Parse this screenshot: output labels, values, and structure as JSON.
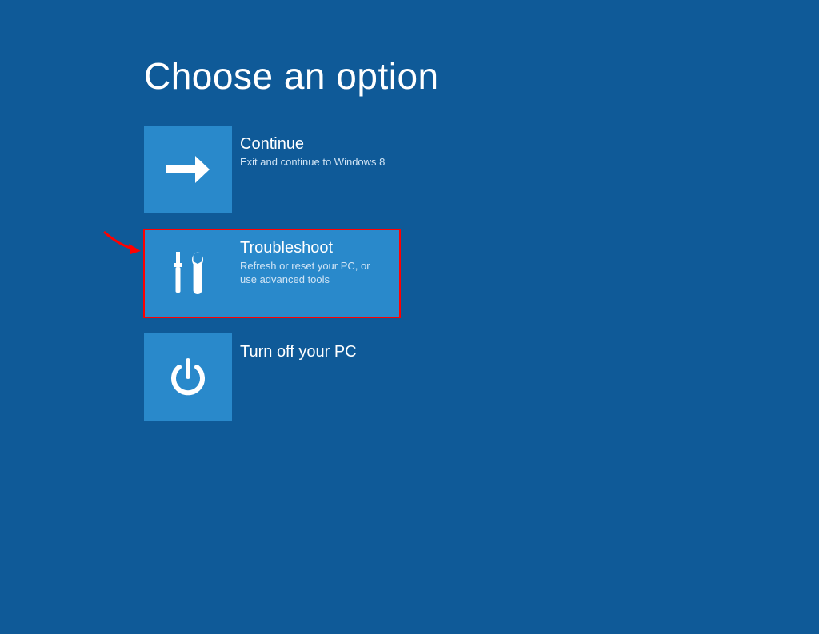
{
  "header": {
    "title": "Choose an option"
  },
  "options": [
    {
      "icon": "arrow-right-icon",
      "title": "Continue",
      "description": "Exit and continue to Windows 8"
    },
    {
      "icon": "tools-icon",
      "title": "Troubleshoot",
      "description": "Refresh or reset your PC, or use advanced tools",
      "highlighted": true
    },
    {
      "icon": "power-icon",
      "title": "Turn off your PC",
      "description": ""
    }
  ],
  "annotation": {
    "type": "red-arrow"
  },
  "colors": {
    "background": "#0F5A98",
    "tile": "#2989CB",
    "highlight": "#ff0000",
    "text": "#ffffff",
    "desc": "#d0e4f5"
  }
}
